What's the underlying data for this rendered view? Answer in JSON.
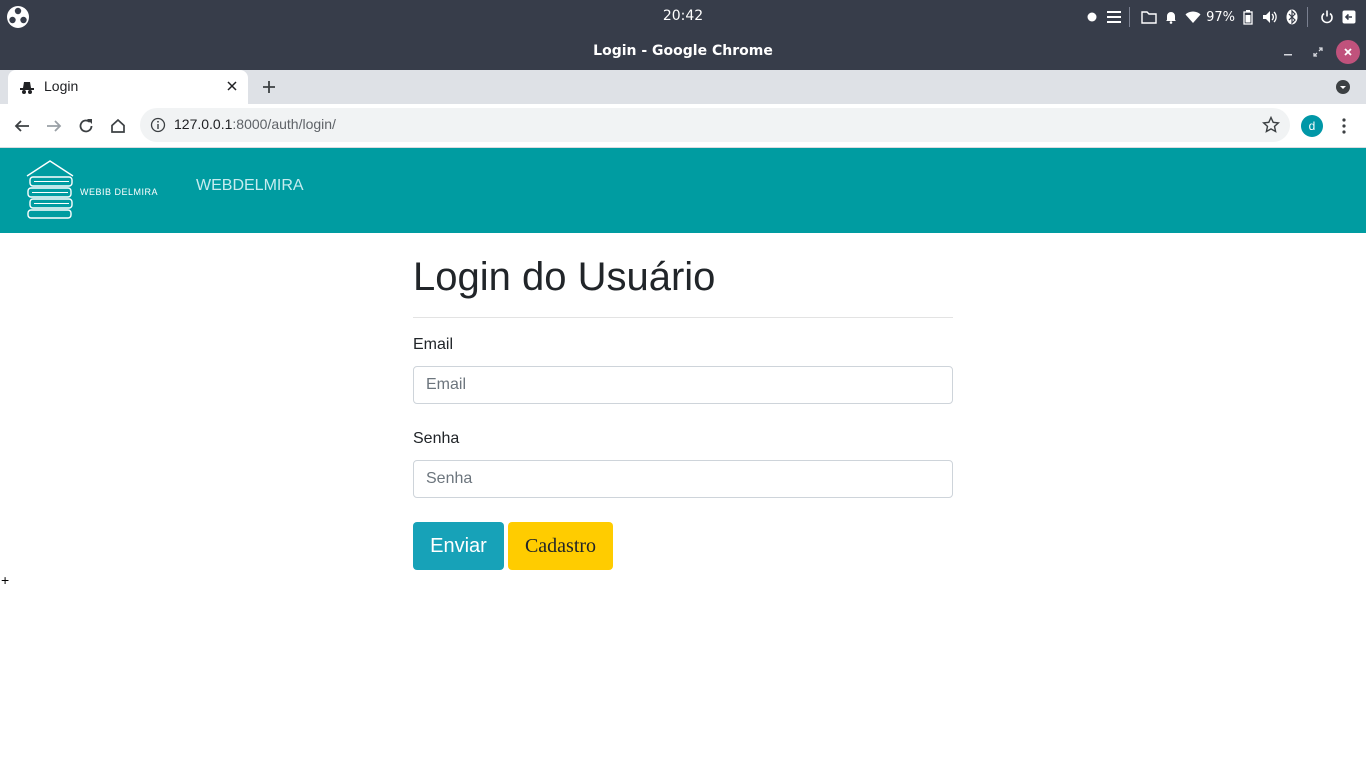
{
  "os": {
    "clock": "20:42",
    "battery_percent": "97%"
  },
  "window": {
    "title": "Login - Google Chrome"
  },
  "browser": {
    "tab_title": "Login",
    "url_host": "127.0.0.1",
    "url_path": ":8000/auth/login/",
    "profile_initial": "d"
  },
  "navbar": {
    "brand_text": "WEBIB DELMIRA",
    "link": "WEBDELMIRA",
    "color": "#009ca1"
  },
  "form": {
    "title": "Login do Usuário",
    "email_label": "Email",
    "email_placeholder": "Email",
    "password_label": "Senha",
    "password_placeholder": "Senha",
    "submit_label": "Enviar",
    "register_label": "Cadastro"
  },
  "stray_text": "+",
  "colors": {
    "submit": "#17a2b8",
    "register": "#ffcc00",
    "os_panel": "#373d4a"
  }
}
